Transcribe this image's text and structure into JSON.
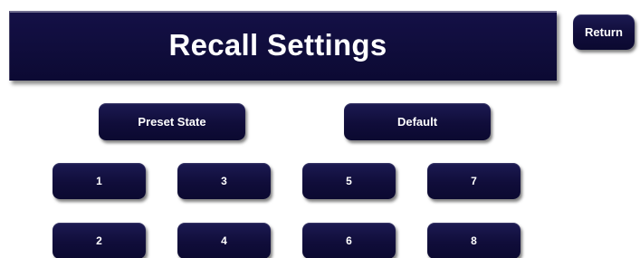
{
  "header": {
    "title": "Recall Settings"
  },
  "nav": {
    "return_label": "Return"
  },
  "actions": {
    "preset_state_label": "Preset State",
    "default_label": "Default"
  },
  "presets": {
    "p1": "1",
    "p2": "2",
    "p3": "3",
    "p4": "4",
    "p5": "5",
    "p6": "6",
    "p7": "7",
    "p8": "8"
  },
  "colors": {
    "button_bg": "#100d3a",
    "title_bg": "#0c0a33",
    "text": "#ffffff",
    "page_bg": "#ffffff"
  }
}
